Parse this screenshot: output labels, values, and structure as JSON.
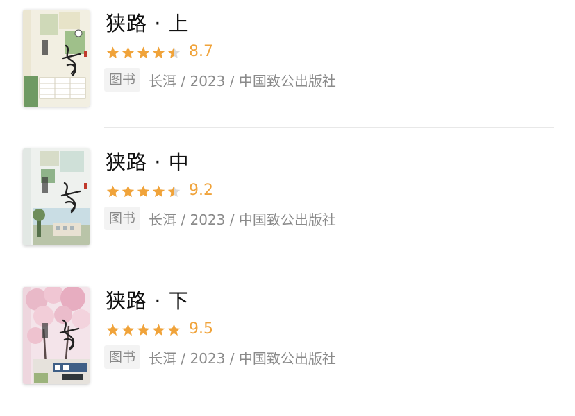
{
  "books": [
    {
      "title": "狭路 · 上",
      "rating": 4.5,
      "score": "8.7",
      "tag": "图书",
      "meta": "长洱 / 2023 / 中国致公出版社"
    },
    {
      "title": "狭路 · 中",
      "rating": 4.5,
      "score": "9.2",
      "tag": "图书",
      "meta": "长洱 / 2023 / 中国致公出版社"
    },
    {
      "title": "狭路 · 下",
      "rating": 5,
      "score": "9.5",
      "tag": "图书",
      "meta": "长洱 / 2023 / 中国致公出版社"
    }
  ],
  "colors": {
    "star": "#f0a33a",
    "star_empty": "#d9d9d9",
    "score": "#f0a33a",
    "meta": "#8a8a8a",
    "tag_bg": "#f3f3f3"
  }
}
